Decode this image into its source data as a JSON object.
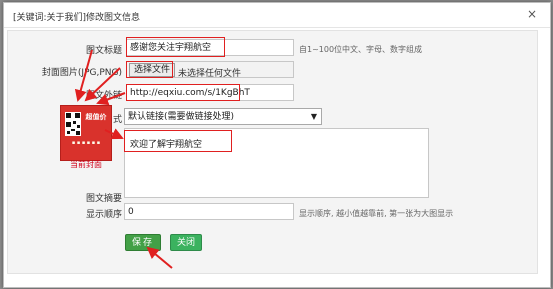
{
  "dialog": {
    "title": "[关键词:关于我们]修改图文信息",
    "close_icon": "×"
  },
  "form": {
    "title_label": "图文标题",
    "title_value": "感谢您关注宇翔航空",
    "title_hint": "自1~100位中文、字母、数字组成",
    "cover_label": "封面图片(JPG,PNG)",
    "file_button": "选择文件",
    "file_status": "未选择任何文件",
    "link_label": "图文外链",
    "link_value": "http://eqxiu.com/s/1KgBhT",
    "mode_label": "式",
    "mode_value": "默认链接(需要做链接处理)",
    "welcome_value": "欢迎了解宇翔航空",
    "summary_label": "图文摘要",
    "order_label": "显示顺序",
    "order_value": "0",
    "order_hint": "显示顺序, 越小值越靠前, 第一张为大图显示"
  },
  "thumbnail": {
    "brand_text": "超值价",
    "caption": "当前封面"
  },
  "buttons": {
    "save": "保存",
    "close": "关闭"
  },
  "colors": {
    "annotation": "#e02020",
    "button_green": "#43a047"
  }
}
